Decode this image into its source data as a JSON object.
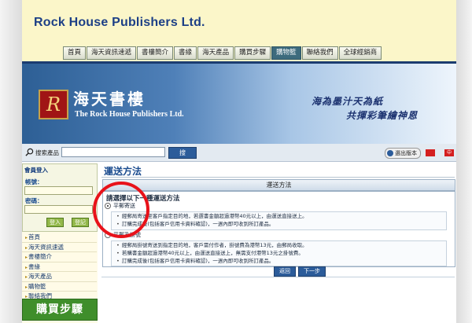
{
  "header": {
    "company": "Rock House Publishers Ltd.",
    "nav": [
      {
        "label": "首頁",
        "active": false
      },
      {
        "label": "海天資訊速遞",
        "active": false
      },
      {
        "label": "書樓簡介",
        "active": false
      },
      {
        "label": "書緣",
        "active": false
      },
      {
        "label": "海天產品",
        "active": false
      },
      {
        "label": "購買步驟",
        "active": false
      },
      {
        "label": "購物籃",
        "active": true
      },
      {
        "label": "聯絡我們",
        "active": false
      },
      {
        "label": "全球經銷商",
        "active": false
      }
    ]
  },
  "banner": {
    "logo_letter": "R",
    "name_cn": "海天書樓",
    "name_en": "The Rock House Publishers Ltd.",
    "slogan_line1": "海為墨汁天為紙",
    "slogan_line2": "共揮彩筆繪神恩"
  },
  "search": {
    "label": "搜索產品",
    "value": "",
    "go_label": "搜",
    "version_label": "選出版本",
    "flag_label": "中"
  },
  "sidebar": {
    "login_title": "會員登入",
    "account_label": "帳號：",
    "password_label": "密碼：",
    "login_button": "登入",
    "register_button": "登記",
    "menu": [
      "首頁",
      "海天資訊速遞",
      "書樓簡介",
      "書緣",
      "海天產品",
      "購物籃",
      "聯絡我們"
    ],
    "buy_steps_label": "購買步驟"
  },
  "main": {
    "title": "運送方法",
    "section_header": "運送方法",
    "panel_title": "請選擇以下一種運送方法",
    "option1": {
      "label": "平郵寄送",
      "selected": true
    },
    "option1_notes": [
      "經郵局寄送至客戶指定目的地，若選書金額超過港幣40元以上，由運送直接送上。",
      "訂購完成後(包括客戶信用卡資料確認)，一週內即可收到所訂產品。"
    ],
    "option2": {
      "label": "平郵及掛號",
      "selected": false
    },
    "option2_notes": [
      "經郵局掛號寄送到指定目的地，客戶需付作者，掛號費為港幣13元，由郵局收取。",
      "若購書金額超過港幣40元以上，由運送直接送上，無需支付港幣13元之掛號費。",
      "訂購完成後(包括客戶信用卡資料確認)，一週內即可收到所訂產品。"
    ],
    "back_button": "返回",
    "next_button": "下一步"
  },
  "colors": {
    "brand_blue": "#1c3f86",
    "nav_active": "#3d6b7d",
    "annotation_red": "#e8121a",
    "buy_green": "#3f8e2b"
  }
}
